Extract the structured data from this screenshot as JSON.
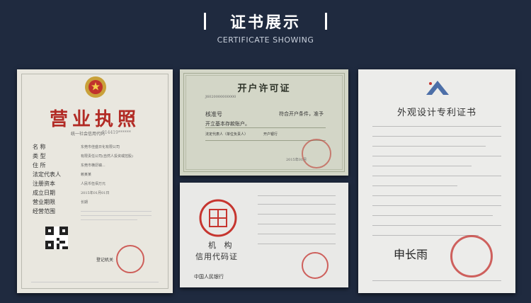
{
  "header": {
    "title": "证书展示",
    "subtitle": "CERTIFICATE SHOWING"
  },
  "certificates": {
    "business_license": {
      "title": "营业执照",
      "credit_code_label": "统一社会信用代码",
      "fields": [
        {
          "label": "名 称",
          "value": "东莞市佳盛日化有限公司"
        },
        {
          "label": "类 型",
          "value": "有限责任公司(自然人投资或控股)"
        },
        {
          "label": "住 所",
          "value": "东莞市横沥镇..."
        },
        {
          "label": "法定代表人",
          "value": "赖某某"
        },
        {
          "label": "注册资本",
          "value": "人民币伍佰万元"
        },
        {
          "label": "成立日期",
          "value": "2015年01月01日"
        },
        {
          "label": "营业期限",
          "value": "长期"
        },
        {
          "label": "经营范围",
          "value": ""
        }
      ],
      "registration_authority": "登记机关"
    },
    "account_permit": {
      "title": "开户许可证",
      "approval_label": "核准号",
      "row1": "符合开户条件，准予",
      "row2": "开立基本存款账户。",
      "rep_label": "法定代表人（单位负责人）",
      "bank_label": "开户银行"
    },
    "org_code": {
      "title": "机 构",
      "title2": "信用代码证",
      "footer": "中国人民银行"
    },
    "patent": {
      "title": "外观设计专利证书",
      "signature": "申长雨"
    }
  }
}
